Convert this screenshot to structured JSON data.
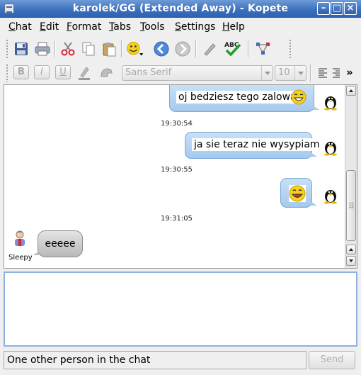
{
  "window": {
    "title": "karolek/GG (Extended Away) - Kopete"
  },
  "menu": [
    {
      "label": "Chat",
      "key": "C",
      "rest": "hat"
    },
    {
      "label": "Edit",
      "key": "E",
      "rest": "dit"
    },
    {
      "label": "Format",
      "key": "F",
      "rest": "ormat"
    },
    {
      "label": "Tabs",
      "key": "T",
      "rest": "abs"
    },
    {
      "label": "Tools",
      "key": "T",
      "rest": "ools"
    },
    {
      "label": "Settings",
      "key": "S",
      "rest": "ettings"
    },
    {
      "label": "Help",
      "key": "H",
      "rest": "elp"
    }
  ],
  "format_toolbar": {
    "bold": "B",
    "italic": "I",
    "underline": "U",
    "font_family": "Sans Serif",
    "font_size": "10",
    "more": "»"
  },
  "messages": [
    {
      "direction": "outgoing",
      "text": "oj bedziesz tego zalowal",
      "emoticon": true
    },
    {
      "timestamp": "19:30:54"
    },
    {
      "direction": "outgoing",
      "text": "ja sie teraz nie wysypiam",
      "emoticon": false
    },
    {
      "timestamp": "19:30:55"
    },
    {
      "direction": "outgoing",
      "text": "",
      "emoticon": true
    },
    {
      "timestamp": "19:31:05"
    },
    {
      "direction": "incoming",
      "sender": "Sleepy",
      "text": "eeeee"
    }
  ],
  "status_text": "One other person in the chat",
  "send_label": "Send",
  "colors": {
    "titlebar": "#3a6fbd",
    "outgoing_bubble": "#a5c9ed",
    "incoming_bubble": "#b8b8b8",
    "input_border": "#8eb1e0"
  }
}
